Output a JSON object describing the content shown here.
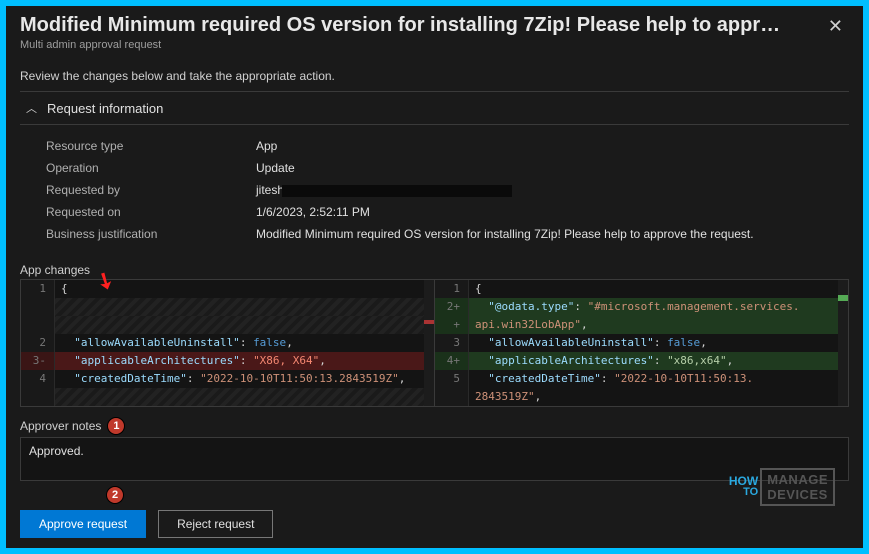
{
  "header": {
    "title": "Modified Minimum required OS version for installing 7Zip! Please help to appr…",
    "subtitle": "Multi admin approval request",
    "close_icon": "✕"
  },
  "instruction": "Review the changes below and take the appropriate action.",
  "section": {
    "title": "Request information",
    "rows": {
      "resource_type_label": "Resource type",
      "resource_type_value": "App",
      "operation_label": "Operation",
      "operation_value": "Update",
      "requested_by_label": "Requested by",
      "requested_by_value": "jitesh",
      "requested_on_label": "Requested on",
      "requested_on_value": "1/6/2023, 2:52:11 PM",
      "justification_label": "Business justification",
      "justification_value": "Modified Minimum required OS version for installing 7Zip! Please help to approve the request."
    }
  },
  "app_changes_label": "App changes",
  "diff": {
    "left": [
      {
        "num": "1",
        "cls": "",
        "content": [
          {
            "t": "{",
            "c": "tk-punc"
          }
        ]
      },
      {
        "num": "",
        "cls": "hatch",
        "content": []
      },
      {
        "num": "",
        "cls": "hatch",
        "content": []
      },
      {
        "num": "2",
        "cls": "",
        "content": [
          {
            "t": "  \"allowAvailableUninstall\"",
            "c": "tk-key"
          },
          {
            "t": ": ",
            "c": "tk-punc"
          },
          {
            "t": "false",
            "c": "tk-bool"
          },
          {
            "t": ",",
            "c": "tk-punc"
          }
        ]
      },
      {
        "num": "3",
        "sign": "-",
        "cls": "line-del",
        "content": [
          {
            "t": "  \"applicableArchitectures\"",
            "c": "tk-key"
          },
          {
            "t": ": ",
            "c": "tk-punc"
          },
          {
            "t": "\"X86, X64\"",
            "c": "tk-old"
          },
          {
            "t": ",",
            "c": "tk-punc"
          }
        ]
      },
      {
        "num": "4",
        "cls": "",
        "content": [
          {
            "t": "  \"createdDateTime\"",
            "c": "tk-key"
          },
          {
            "t": ": ",
            "c": "tk-punc"
          },
          {
            "t": "\"2022-10-10T11:50:13.2843519Z\"",
            "c": "tk-str"
          },
          {
            "t": ",",
            "c": "tk-punc"
          }
        ]
      },
      {
        "num": "",
        "cls": "hatch",
        "content": []
      }
    ],
    "right": [
      {
        "num": "1",
        "cls": "",
        "content": [
          {
            "t": "{",
            "c": "tk-punc"
          }
        ]
      },
      {
        "num": "2",
        "sign": "+",
        "cls": "line-add",
        "content": [
          {
            "t": "  \"@odata.type\"",
            "c": "tk-key"
          },
          {
            "t": ": ",
            "c": "tk-punc"
          },
          {
            "t": "\"#microsoft.management.services.",
            "c": "tk-str"
          }
        ]
      },
      {
        "num": "",
        "sign": "+",
        "cls": "line-add",
        "content": [
          {
            "t": "api.win32LobApp\"",
            "c": "tk-str"
          },
          {
            "t": ",",
            "c": "tk-punc"
          }
        ]
      },
      {
        "num": "3",
        "cls": "",
        "content": [
          {
            "t": "  \"allowAvailableUninstall\"",
            "c": "tk-key"
          },
          {
            "t": ": ",
            "c": "tk-punc"
          },
          {
            "t": "false",
            "c": "tk-bool"
          },
          {
            "t": ",",
            "c": "tk-punc"
          }
        ]
      },
      {
        "num": "4",
        "sign": "+",
        "cls": "line-add",
        "content": [
          {
            "t": "  \"applicableArchitectures\"",
            "c": "tk-key"
          },
          {
            "t": ": ",
            "c": "tk-punc"
          },
          {
            "t": "\"x86,x64\"",
            "c": "tk-new"
          },
          {
            "t": ",",
            "c": "tk-punc"
          }
        ]
      },
      {
        "num": "5",
        "cls": "",
        "content": [
          {
            "t": "  \"createdDateTime\"",
            "c": "tk-key"
          },
          {
            "t": ": ",
            "c": "tk-punc"
          },
          {
            "t": "\"2022-10-10T11:50:13.",
            "c": "tk-str"
          }
        ]
      },
      {
        "num": "",
        "cls": "",
        "content": [
          {
            "t": "2843519Z\"",
            "c": "tk-str"
          },
          {
            "t": ",",
            "c": "tk-punc"
          }
        ]
      }
    ]
  },
  "notes": {
    "label": "Approver notes",
    "value": "Approved."
  },
  "buttons": {
    "approve": "Approve request",
    "reject": "Reject request"
  },
  "annotations": {
    "badge1": "1",
    "badge2": "2"
  },
  "logo": {
    "how": "HOW",
    "to": "TO",
    "manage": "MANAGE",
    "devices": "DEVICES"
  }
}
